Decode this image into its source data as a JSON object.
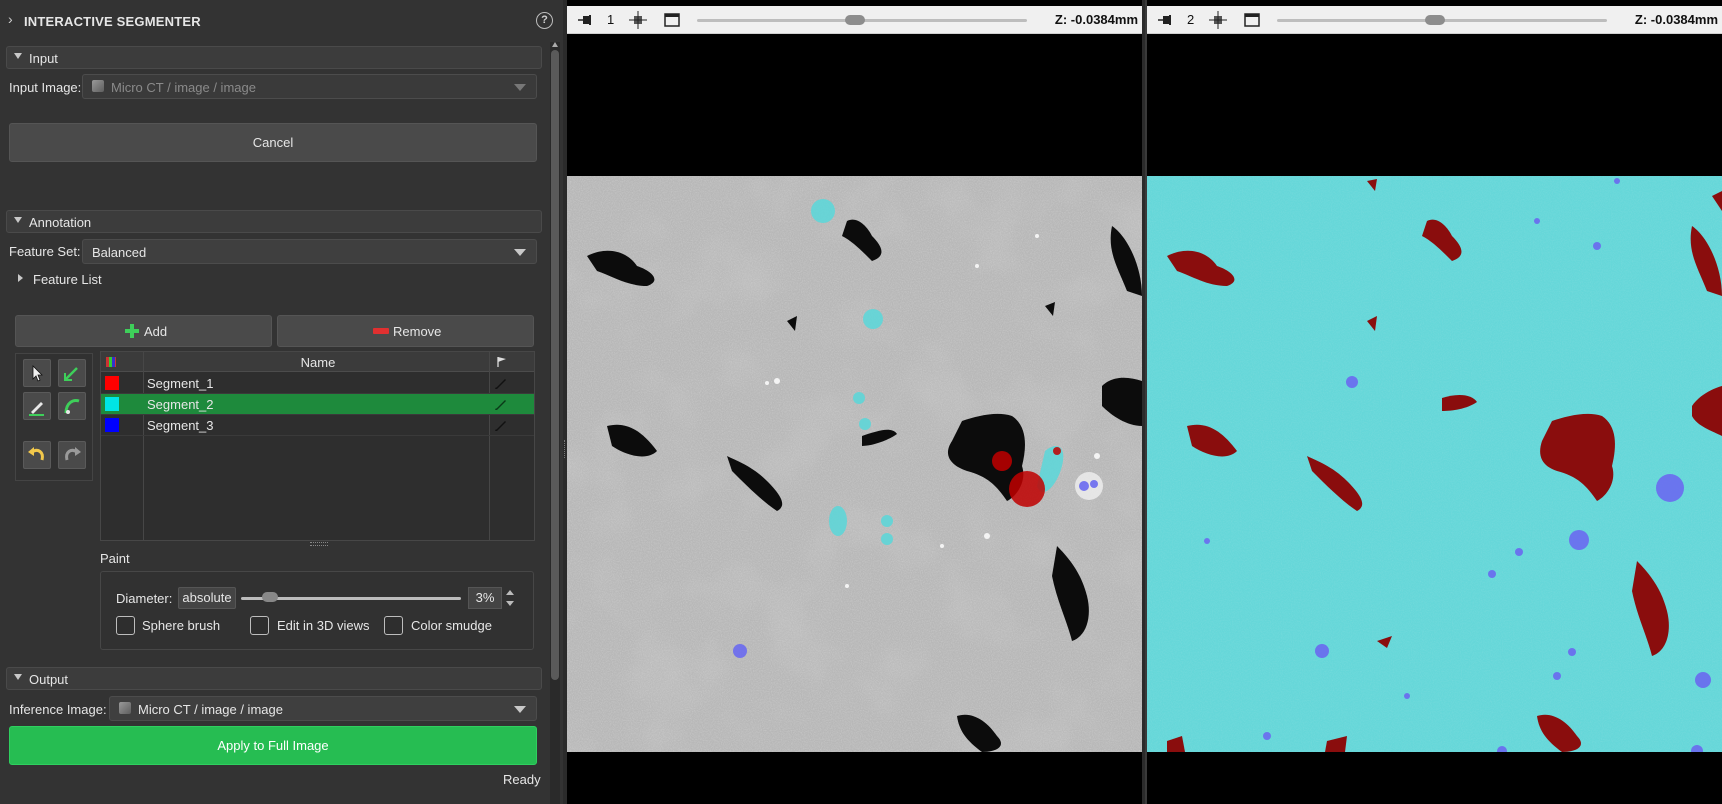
{
  "panel": {
    "title": "INTERACTIVE SEGMENTER",
    "help_icon": "question-circle-icon"
  },
  "input_section": {
    "header": "Input",
    "input_image_label": "Input Image:",
    "input_image_value": "Micro CT / image / image",
    "cancel_label": "Cancel"
  },
  "annotation": {
    "header": "Annotation",
    "feature_set_label": "Feature Set:",
    "feature_set_value": "Balanced",
    "feature_list_label": "Feature List",
    "add_label": "Add",
    "remove_label": "Remove",
    "table_header_name": "Name",
    "segments": [
      {
        "name": "Segment_1",
        "color": "#ff0000"
      },
      {
        "name": "Segment_2",
        "color": "#00e5e5",
        "selected": true
      },
      {
        "name": "Segment_3",
        "color": "#0000ff"
      }
    ]
  },
  "paint": {
    "label": "Paint",
    "diameter_label": "Diameter:",
    "diameter_mode": "absolute",
    "diameter_value": "3%",
    "diameter_fraction": 0.13,
    "sphere_brush_label": "Sphere brush",
    "edit_3d_label": "Edit in 3D views",
    "color_smudge_label": "Color smudge"
  },
  "output": {
    "header": "Output",
    "inference_label": "Inference Image:",
    "inference_value": "Micro CT / image / image",
    "apply_label": "Apply to Full Image",
    "status": "Ready"
  },
  "views": [
    {
      "number": "1",
      "z_label": "Z: -0.0384mm",
      "slice_fraction": 0.48
    },
    {
      "number": "2",
      "z_label": "Z: -0.0384mm",
      "slice_fraction": 0.48
    }
  ],
  "colors": {
    "accent_green": "#26bd52",
    "selected_row": "#1e8a3c",
    "segment_cyan": "#5fd6d8",
    "segment_red": "#8a0d0d",
    "segment_blue": "#6a6af0"
  }
}
